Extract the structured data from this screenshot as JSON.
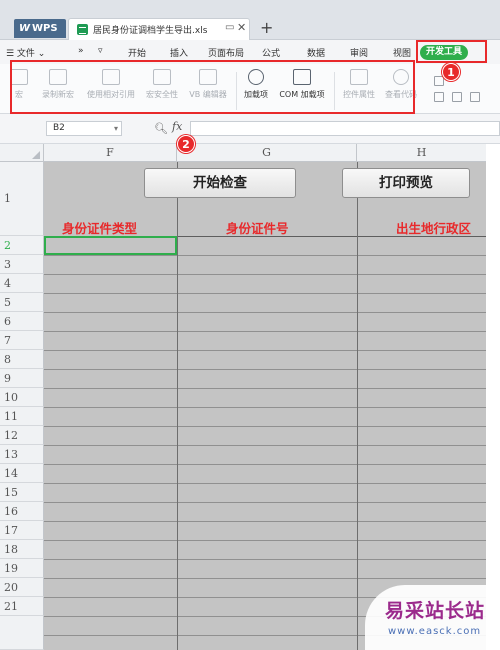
{
  "titlebar": {
    "app_tab": "WPS",
    "doc_name": "居民身份证调档学生导出.xls",
    "pin_icon": "pin-icon",
    "close_icon": "close-icon",
    "new_tab": "+"
  },
  "menu": {
    "hamburger": "☰ 文件 ⌄",
    "more1": "»",
    "more2": "▿",
    "items": [
      "开始",
      "插入",
      "页面布局",
      "公式",
      "数据",
      "审阅",
      "视图"
    ],
    "dev_tab": "开发工具"
  },
  "badges": {
    "one": "1",
    "two": "2"
  },
  "ribbon": {
    "buttons": [
      {
        "label": "宏",
        "active": false
      },
      {
        "label": "录制新宏",
        "active": false
      },
      {
        "label": "使用相对引用",
        "active": false
      },
      {
        "label": "宏安全性",
        "active": false
      },
      {
        "label": "VB 编辑器",
        "active": false
      },
      {
        "label": "加载项",
        "active": true
      },
      {
        "label": "COM 加载项",
        "active": true
      },
      {
        "label": "控件属性",
        "active": false
      },
      {
        "label": "查看代码",
        "active": false
      }
    ]
  },
  "formula_bar": {
    "cell_ref": "B2",
    "fx": "fx"
  },
  "grid": {
    "columns": [
      "F",
      "G",
      "H"
    ],
    "rows": [
      "1",
      "2",
      "3",
      "4",
      "5",
      "6",
      "7",
      "8",
      "9",
      "10",
      "11",
      "12",
      "13",
      "14",
      "15",
      "16",
      "17",
      "18",
      "19",
      "20",
      "21"
    ],
    "selected_row": "2",
    "buttons": [
      "开始检查",
      "打印预览"
    ],
    "headers": [
      "身份证件类型",
      "身份证件号",
      "出生地行政区"
    ]
  },
  "watermark": {
    "title": "易采站长站",
    "url": "www.easck.com"
  }
}
